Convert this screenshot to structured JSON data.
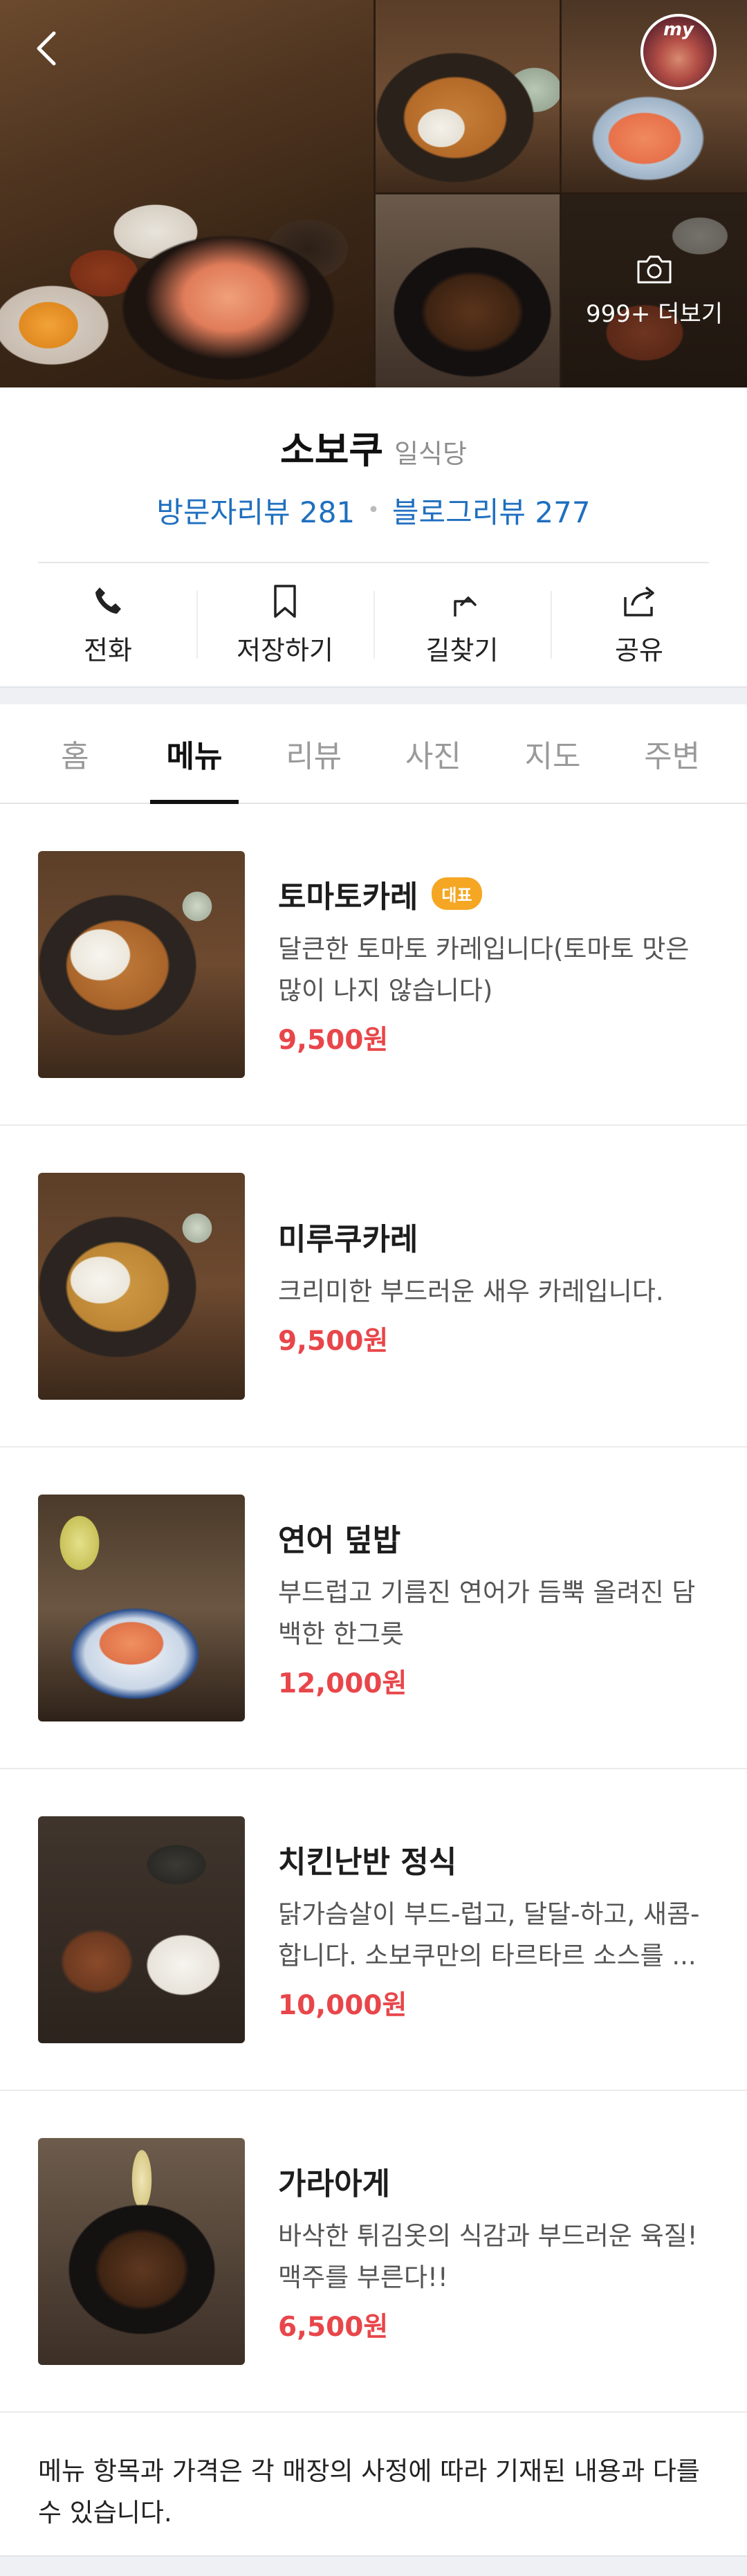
{
  "gallery": {
    "more_photos_label": "999+ 더보기",
    "my_badge": "my"
  },
  "place": {
    "name": "소보쿠",
    "category": "일식당",
    "visitor_reviews": "방문자리뷰 281",
    "blog_reviews": "블로그리뷰 277"
  },
  "actions": [
    {
      "label": "전화",
      "icon": "phone-icon"
    },
    {
      "label": "저장하기",
      "icon": "bookmark-icon"
    },
    {
      "label": "길찾기",
      "icon": "directions-icon"
    },
    {
      "label": "공유",
      "icon": "share-icon"
    }
  ],
  "tabs": [
    {
      "label": "홈"
    },
    {
      "label": "메뉴",
      "active": true
    },
    {
      "label": "리뷰"
    },
    {
      "label": "사진"
    },
    {
      "label": "지도"
    },
    {
      "label": "주변"
    }
  ],
  "menu": [
    {
      "name": "토마토카레",
      "badge": "대표",
      "desc": "달큰한 토마토 카레입니다(토마토 맛은 많이 나지 않습니다)",
      "price": "9,500원"
    },
    {
      "name": "미루쿠카레",
      "desc": "크리미한 부드러운 새우 카레입니다.",
      "price": "9,500원"
    },
    {
      "name": "연어 덮밥",
      "desc": "부드럽고 기름진 연어가 듬뿍 올려진 담백한 한그릇",
      "price": "12,000원"
    },
    {
      "name": "치킨난반 정식",
      "desc": "닭가슴살이 부드-럽고, 달달-하고, 새콤-합니다. 소보쿠만의 타르타르 소스를 ...",
      "price": "10,000원"
    },
    {
      "name": "가라아게",
      "desc": "바삭한 튀김옷의 식감과 부드러운 육질! 맥주를 부른다!!",
      "price": "6,500원"
    }
  ],
  "notice": "메뉴 항목과 가격은 각 매장의 사정에 따라 기재된 내용과 다를 수 있습니다.",
  "colors": {
    "review_link": "#1f6fbf",
    "price": "#e8464a",
    "badge": "#f5a623",
    "active_tab": "#111111"
  }
}
